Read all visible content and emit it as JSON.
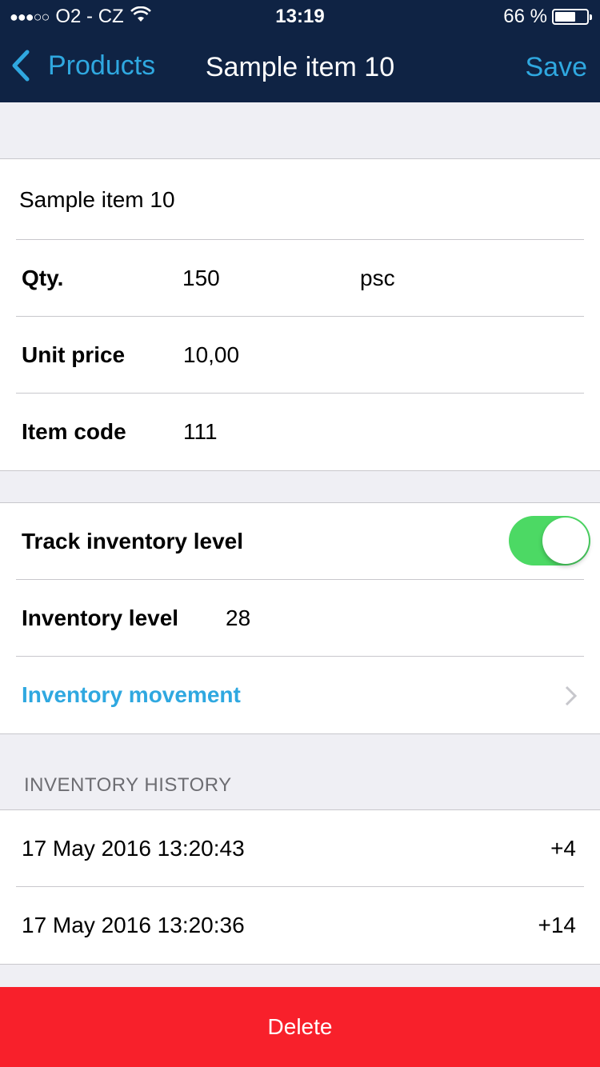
{
  "status_bar": {
    "signal": "●●●○○",
    "carrier": "O2 - CZ",
    "time": "13:19",
    "battery_text": "66 %",
    "battery_level": 0.66
  },
  "nav": {
    "back_label": "Products",
    "title": "Sample item 10",
    "save_label": "Save"
  },
  "item": {
    "name": "Sample item 10",
    "qty_label": "Qty.",
    "qty_value": "150",
    "qty_unit": "psc",
    "price_label": "Unit price",
    "price_value": "10,00",
    "code_label": "Item code",
    "code_value": "111"
  },
  "inventory": {
    "track_label": "Track inventory level",
    "track_enabled": true,
    "level_label": "Inventory level",
    "level_value": "28",
    "movement_label": "Inventory movement"
  },
  "history": {
    "header": "INVENTORY HISTORY",
    "entries": [
      {
        "date": "17 May 2016 13:20:43",
        "amount": "+4"
      },
      {
        "date": "17 May 2016 13:20:36",
        "amount": "+14"
      }
    ]
  },
  "delete_label": "Delete",
  "colors": {
    "nav_bg": "#0f2344",
    "accent": "#2fa8e0",
    "toggle_on": "#4cd964",
    "delete": "#f8202b"
  }
}
